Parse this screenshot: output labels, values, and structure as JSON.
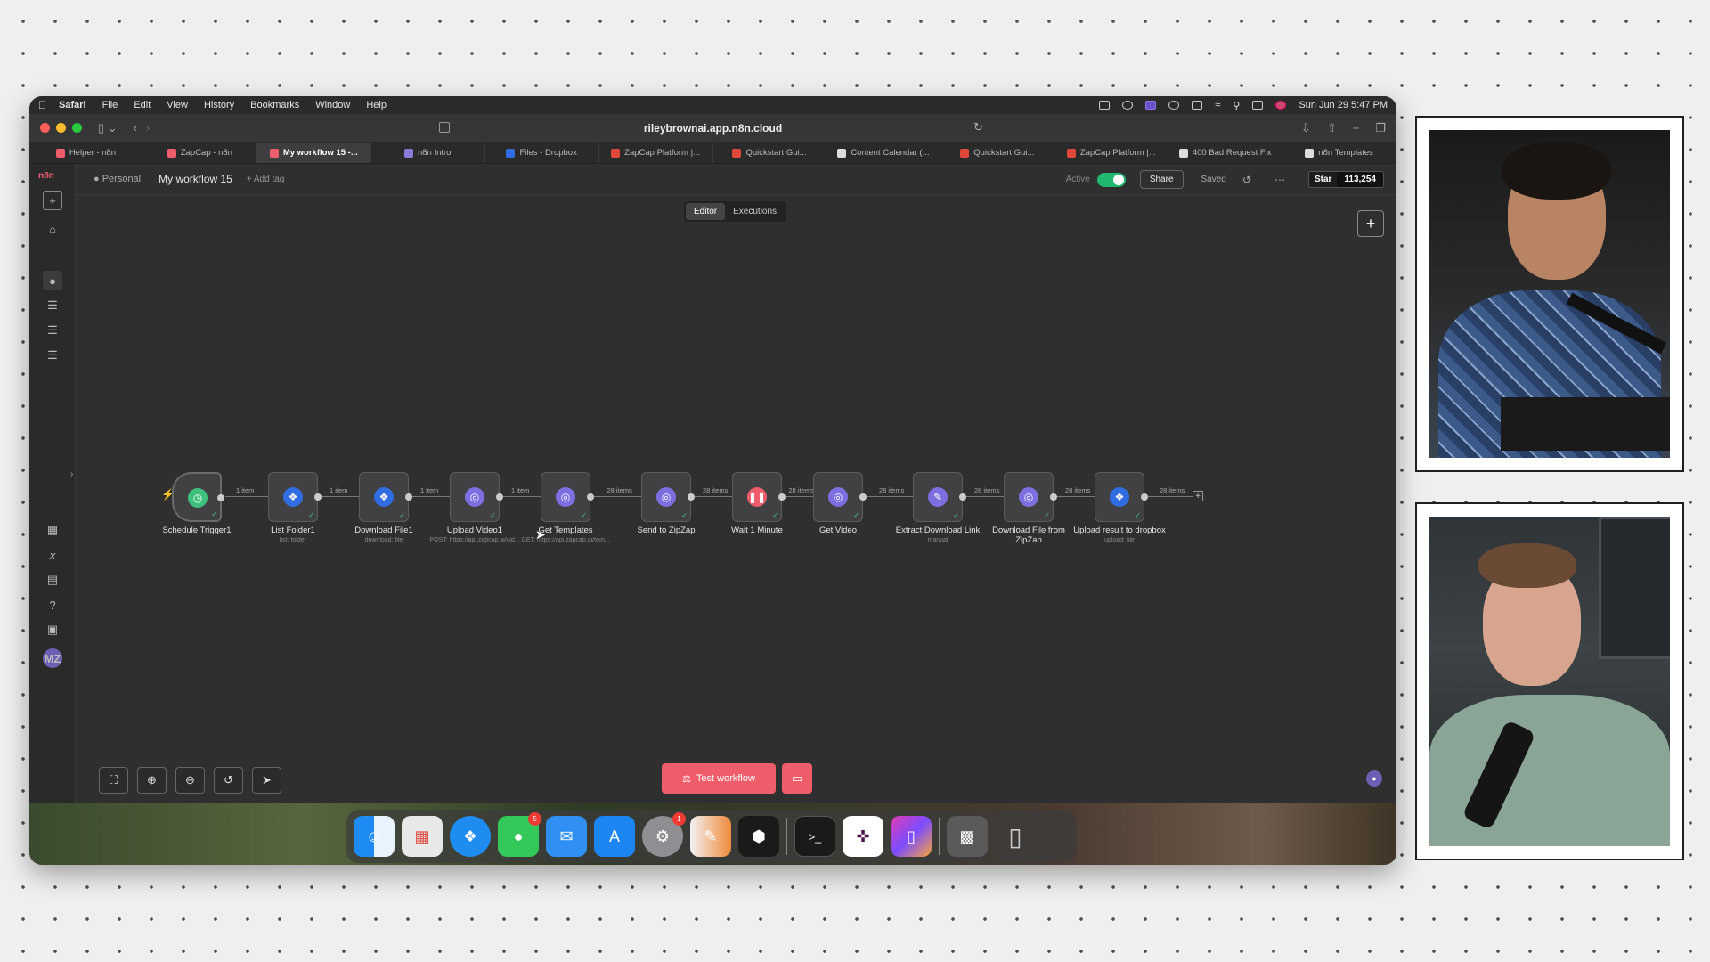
{
  "menubar": {
    "app": "Safari",
    "items": [
      "File",
      "Edit",
      "View",
      "History",
      "Bookmarks",
      "Window",
      "Help"
    ],
    "clock": "Sun Jun 29  5:47 PM"
  },
  "browser": {
    "url": "rileybrownai.app.n8n.cloud",
    "tabs": [
      {
        "label": "Helper - n8n",
        "color": "#ee5d6c"
      },
      {
        "label": "ZapCap - n8n",
        "color": "#ee5d6c"
      },
      {
        "label": "My workflow 15 -...",
        "color": "#ee5d6c",
        "active": true
      },
      {
        "label": "n8n Intro",
        "color": "#8a7bd8"
      },
      {
        "label": "Files - Dropbox",
        "color": "#2f6de0"
      },
      {
        "label": "ZapCap Platform |...",
        "color": "#e0483c"
      },
      {
        "label": "Quickstart Gui...",
        "color": "#e0483c"
      },
      {
        "label": "Content Calendar (...",
        "color": "#dddddd"
      },
      {
        "label": "Quickstart Gui...",
        "color": "#e0483c"
      },
      {
        "label": "ZapCap Platform |...",
        "color": "#e0483c"
      },
      {
        "label": "400 Bad Request Fix",
        "color": "#dddddd"
      },
      {
        "label": "n8n Templates",
        "color": "#dddddd"
      }
    ]
  },
  "header": {
    "project": "Personal",
    "workflow_name": "My workflow 15",
    "add_tag": "+ Add tag",
    "active_label": "Active",
    "share": "Share",
    "saved": "Saved",
    "github_star": "Star",
    "github_count": "113,254"
  },
  "modes": {
    "editor": "Editor",
    "executions": "Executions"
  },
  "nodes": [
    {
      "label": "Schedule Trigger1",
      "sub": "",
      "icon": "clock-icon",
      "color": "#3ec17c"
    },
    {
      "label": "List Folder1",
      "sub": "list: folder",
      "icon": "dropbox-icon",
      "color": "#2f6de0"
    },
    {
      "label": "Download File1",
      "sub": "download: file",
      "icon": "dropbox-icon",
      "color": "#2f6de0"
    },
    {
      "label": "Upload Video1",
      "sub": "POST: https://api.zapcap.ai/vid...",
      "icon": "globe-icon",
      "color": "#7d6fe0"
    },
    {
      "label": "Get Templates",
      "sub": "GET: https://api.zapcap.ai/tem...",
      "icon": "globe-icon",
      "color": "#7d6fe0"
    },
    {
      "label": "Send to ZipZap",
      "sub": "",
      "icon": "globe-icon",
      "color": "#7d6fe0"
    },
    {
      "label": "Wait 1 Minute",
      "sub": "",
      "icon": "pause-icon",
      "color": "#ee5d6c"
    },
    {
      "label": "Get Video",
      "sub": "",
      "icon": "globe-icon",
      "color": "#7d6fe0"
    },
    {
      "label": "Extract Download Link",
      "sub": "manual",
      "icon": "pencil-icon",
      "color": "#7d6fe0"
    },
    {
      "label": "Download File from ZipZap",
      "sub": "",
      "icon": "globe-icon",
      "color": "#7d6fe0"
    },
    {
      "label": "Upload result to dropbox",
      "sub": "upload: file",
      "icon": "dropbox-icon",
      "color": "#2f6de0"
    }
  ],
  "edges": [
    "1 item",
    "1 item",
    "1 item",
    "1 item",
    "28 items",
    "28 items",
    "28 items",
    "28 items",
    "28 items",
    "28 items",
    "28 items"
  ],
  "test_workflow": "Test workflow",
  "sidebar": {
    "logo": "n8n",
    "avatar": "MZ"
  },
  "dock": {
    "messages_badge": "5",
    "settings_badge": "1"
  }
}
